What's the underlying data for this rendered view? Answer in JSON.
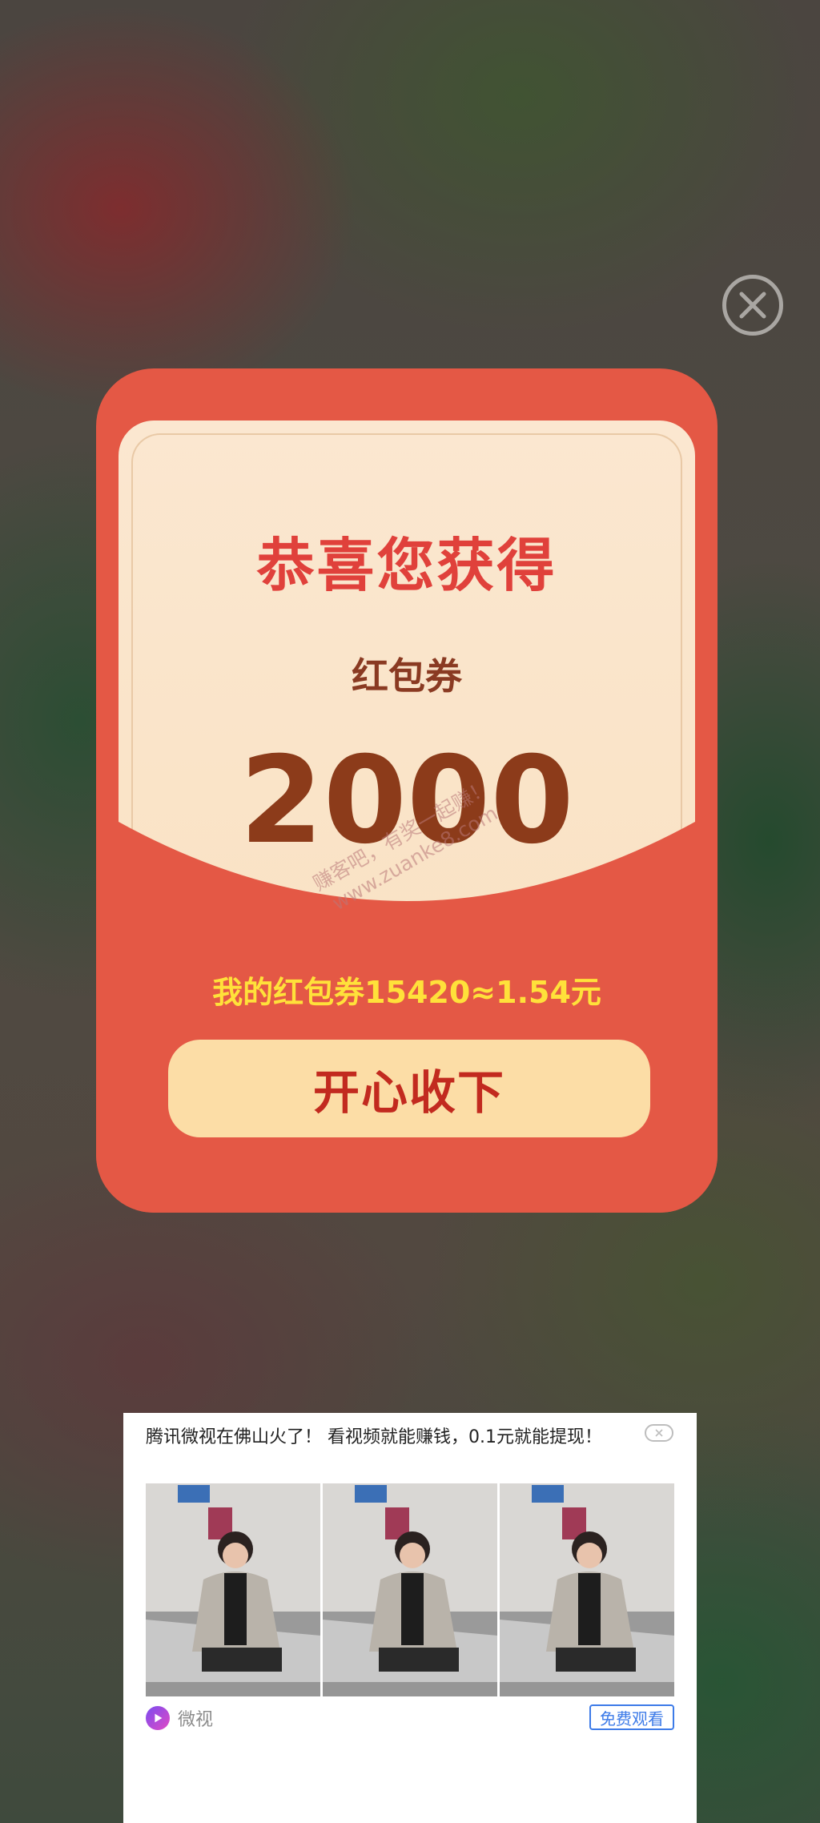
{
  "popup": {
    "title": "恭喜您获得",
    "subtitle": "红包券",
    "amount": "2000",
    "balance_text": "我的红包券15420≈1.54元",
    "accept_label": "开心收下",
    "watermark": "赚客吧，有奖一起赚！\nwww.zuanke8.com"
  },
  "ad": {
    "headline": "腾讯微视在佛山火了！ 看视频就能赚钱，0.1元就能提现！",
    "brand": "微视",
    "cta_label": "免费观看"
  },
  "colors": {
    "packet_red": "#e45845",
    "card_cream": "#fbe7d0",
    "title_red": "#e0413b",
    "amount_brown": "#8c3b1a",
    "balance_yellow": "#ffe13a",
    "button_bg": "#fcdda6",
    "button_text": "#c22a1f",
    "cta_blue": "#3d7be8"
  },
  "icons": {
    "close": "close-icon",
    "ad_close": "close-icon",
    "brand": "weishi-logo-icon"
  }
}
